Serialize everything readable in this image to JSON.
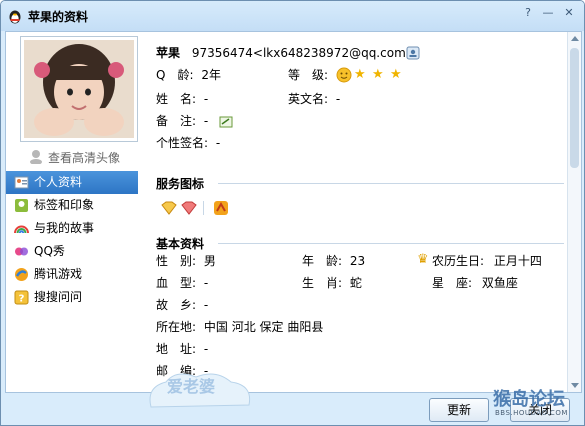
{
  "window": {
    "title": "苹果的资料",
    "btn_help": "?",
    "btn_min": "—",
    "btn_close": "✕"
  },
  "avatar": {
    "hd_link": "查看高清头像"
  },
  "sidebar": {
    "items": [
      {
        "label": "个人资料",
        "icon": "profile-card-icon",
        "active": true
      },
      {
        "label": "标签和印象",
        "icon": "tag-icon"
      },
      {
        "label": "与我的故事",
        "icon": "rainbow-icon"
      },
      {
        "label": "QQ秀",
        "icon": "qqshow-icon"
      },
      {
        "label": "腾讯游戏",
        "icon": "game-icon"
      },
      {
        "label": "搜搜问问",
        "icon": "question-icon"
      }
    ]
  },
  "profile": {
    "nickname": "苹果",
    "qq_email": "97356474<lkx648238972@qq.com>",
    "qage_label": "Q　龄:",
    "qage_value": "2年",
    "level_label": "等　级:",
    "name_label": "姓　名:",
    "name_value": "-",
    "en_name_label": "英文名:",
    "en_name_value": "-",
    "remark_label": "备　注:",
    "remark_value": "-",
    "signature_label": "个性签名:",
    "signature_value": "-"
  },
  "services": {
    "title": "服务图标"
  },
  "basic": {
    "title": "基本资料",
    "gender_label": "性　别:",
    "gender_value": "男",
    "age_label": "年　龄:",
    "age_value": "23",
    "lunar_label": "农历生日:",
    "lunar_value": "正月十四",
    "blood_label": "血　型:",
    "blood_value": "-",
    "zodiac_label": "生　肖:",
    "zodiac_value": "蛇",
    "star_label": "星　座:",
    "star_value": "双鱼座",
    "hometown_label": "故　乡:",
    "hometown_value": "-",
    "location_label": "所在地:",
    "location_value": "中国 河北 保定 曲阳县",
    "address_label": "地　址:",
    "address_value": "-",
    "postcode_label": "邮　编:",
    "postcode_value": "-"
  },
  "footer": {
    "refresh": "更新",
    "close": "关闭"
  },
  "watermark": {
    "text": "猴岛论坛",
    "url": "BBS.HOUDAO.COM"
  },
  "bottom_tag": {
    "text": "爱老婆"
  }
}
